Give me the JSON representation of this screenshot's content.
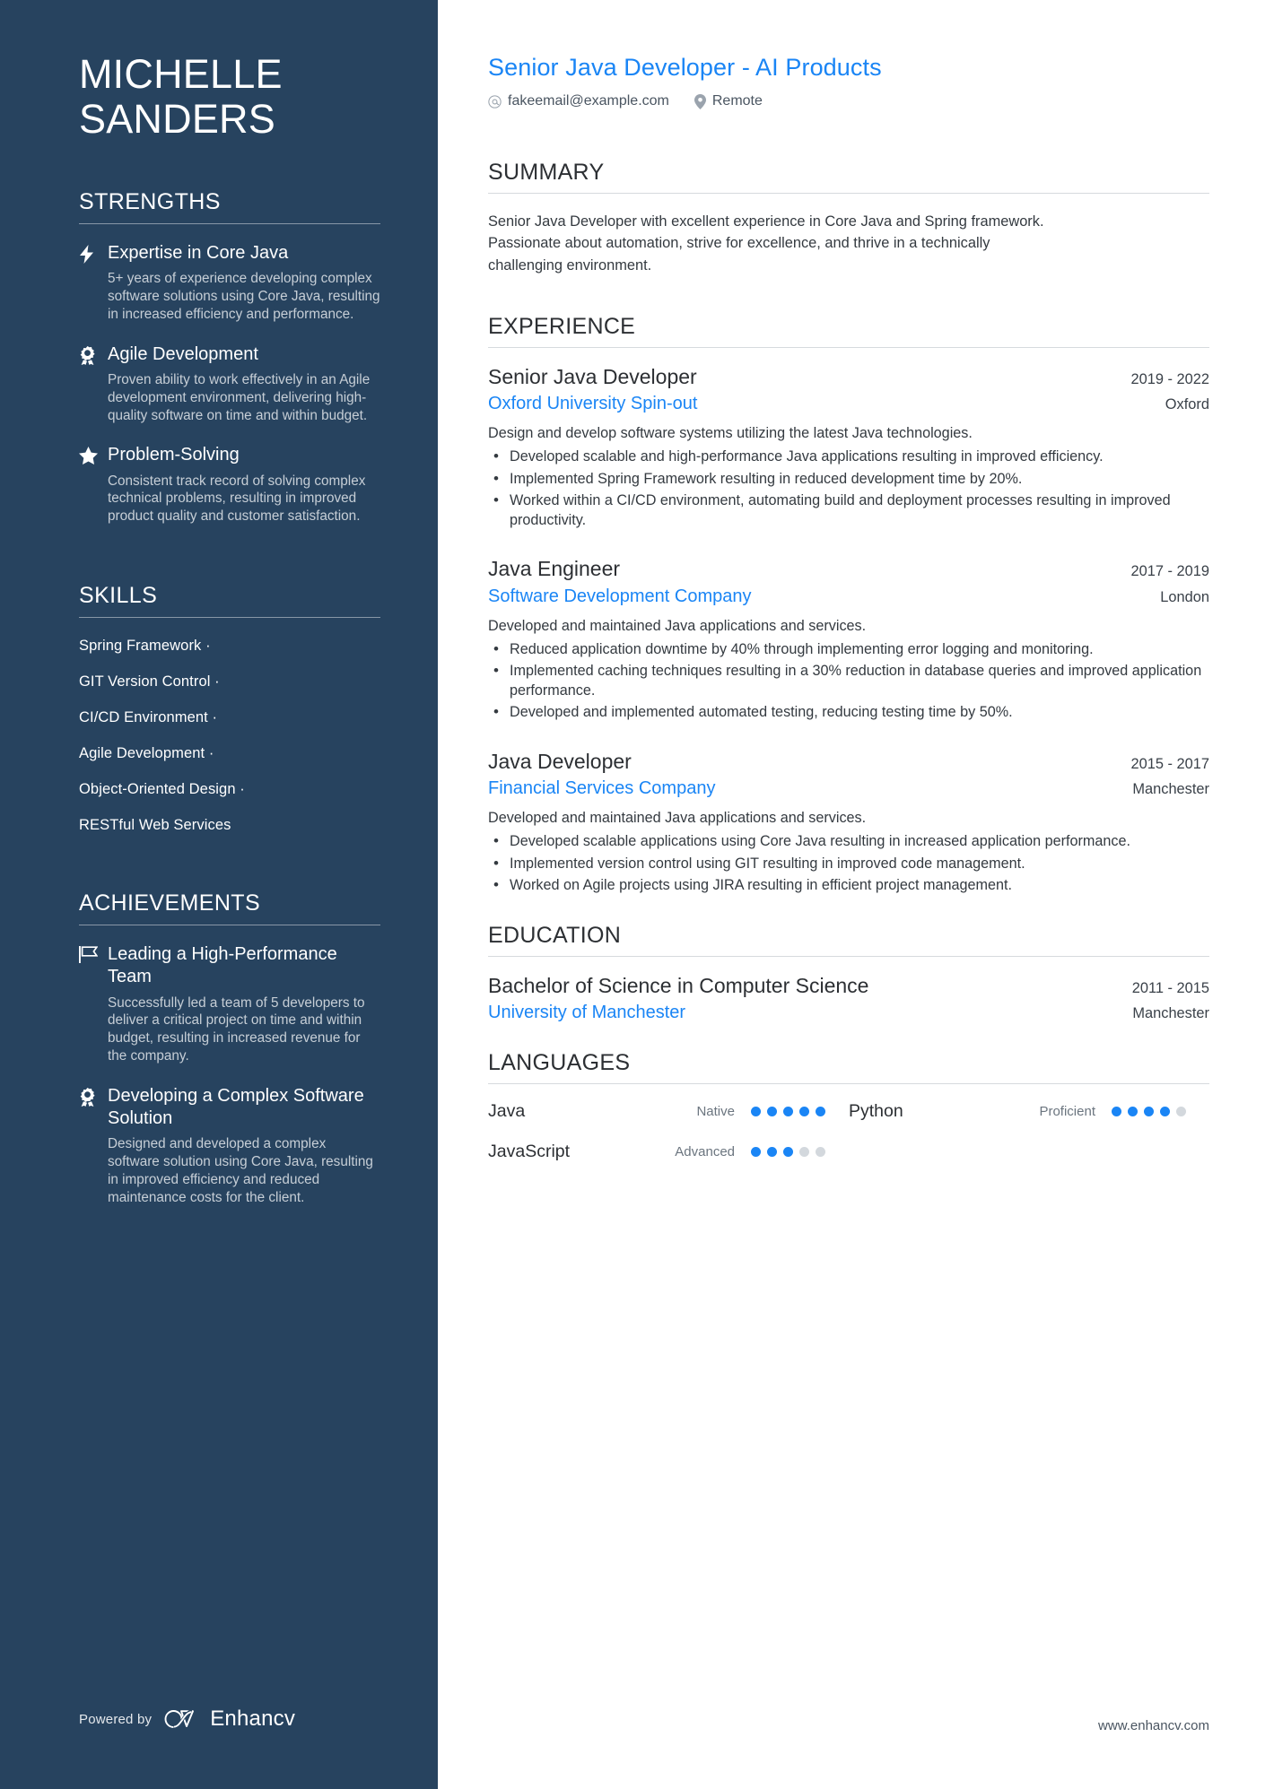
{
  "sidebar": {
    "name": "MICHELLE\nSANDERS",
    "strengths_heading": "STRENGTHS",
    "strengths": [
      {
        "icon": "lightning-bolt-icon",
        "title": "Expertise in Core Java",
        "description": "5+ years of experience developing complex software solutions using Core Java, resulting in increased efficiency and performance."
      },
      {
        "icon": "award-ribbon-icon",
        "title": "Agile Development",
        "description": "Proven ability to work effectively in an Agile development environment, delivering high-quality software on time and within budget."
      },
      {
        "icon": "star-icon",
        "title": "Problem-Solving",
        "description": "Consistent track record of solving complex technical problems, resulting in improved product quality and customer satisfaction."
      }
    ],
    "skills_heading": "SKILLS",
    "skills": [
      "Spring Framework ·",
      "GIT Version Control ·",
      "CI/CD Environment ·",
      "Agile Development ·",
      "Object-Oriented Design ·",
      "RESTful Web Services"
    ],
    "achievements_heading": "ACHIEVEMENTS",
    "achievements": [
      {
        "icon": "flag-icon",
        "title": "Leading a High-Performance Team",
        "description": "Successfully led a team of 5 developers to deliver a critical project on time and within budget, resulting in increased revenue for the company."
      },
      {
        "icon": "award-ribbon-icon",
        "title": "Developing a Complex Software Solution",
        "description": "Designed and developed a complex software solution using Core Java, resulting in improved efficiency and reduced maintenance costs for the client."
      }
    ],
    "footer": {
      "powered_by": "Powered by",
      "brand": "Enhancv",
      "brand_logo_icon": "enhancv-infinity-icon"
    }
  },
  "main": {
    "job_title": "Senior Java Developer - AI Products",
    "contacts": [
      {
        "icon": "at-sign-icon",
        "text": "fakeemail@example.com"
      },
      {
        "icon": "map-pin-icon",
        "text": "Remote"
      }
    ],
    "summary": {
      "heading": "SUMMARY",
      "text": "Senior Java Developer with excellent experience in Core Java and Spring framework. Passionate about automation, strive for excellence, and thrive in a technically challenging environment."
    },
    "experience": {
      "heading": "EXPERIENCE",
      "jobs": [
        {
          "role": "Senior Java Developer",
          "dates": "2019 - 2022",
          "company": "Oxford University Spin-out",
          "location": "Oxford",
          "description": "Design and develop software systems utilizing the latest Java technologies.",
          "bullets": [
            "Developed scalable and high-performance Java applications resulting in improved efficiency.",
            "Implemented Spring Framework resulting in reduced development time by 20%.",
            "Worked within a CI/CD environment, automating build and deployment processes resulting in improved productivity."
          ]
        },
        {
          "role": "Java Engineer",
          "dates": "2017 - 2019",
          "company": "Software Development Company",
          "location": "London",
          "description": "Developed and maintained Java applications and services.",
          "bullets": [
            "Reduced application downtime by 40% through implementing error logging and monitoring.",
            "Implemented caching techniques resulting in a 30% reduction in database queries and improved application performance.",
            "Developed and implemented automated testing, reducing testing time by 50%."
          ]
        },
        {
          "role": "Java Developer",
          "dates": "2015 - 2017",
          "company": "Financial Services Company",
          "location": "Manchester",
          "description": "Developed and maintained Java applications and services.",
          "bullets": [
            "Developed scalable applications using Core Java resulting in increased application performance.",
            "Implemented version control using GIT resulting in improved code management.",
            "Worked on Agile projects using JIRA resulting in efficient project management."
          ]
        }
      ]
    },
    "education": {
      "heading": "EDUCATION",
      "entries": [
        {
          "degree": "Bachelor of Science in Computer Science",
          "dates": "2011 - 2015",
          "school": "University of Manchester",
          "location": "Manchester"
        }
      ]
    },
    "languages": {
      "heading": "LANGUAGES",
      "items": [
        {
          "name": "Java",
          "level": "Native",
          "dots_filled": 5,
          "dots_total": 5
        },
        {
          "name": "Python",
          "level": "Proficient",
          "dots_filled": 4,
          "dots_total": 5
        },
        {
          "name": "JavaScript",
          "level": "Advanced",
          "dots_filled": 3,
          "dots_total": 5
        }
      ]
    },
    "site_url": "www.enhancv.com"
  },
  "colors": {
    "sidebar_bg": "#27435f",
    "accent_blue": "#1a85f5",
    "body_text": "#343a40",
    "muted_text": "#6b757f"
  }
}
